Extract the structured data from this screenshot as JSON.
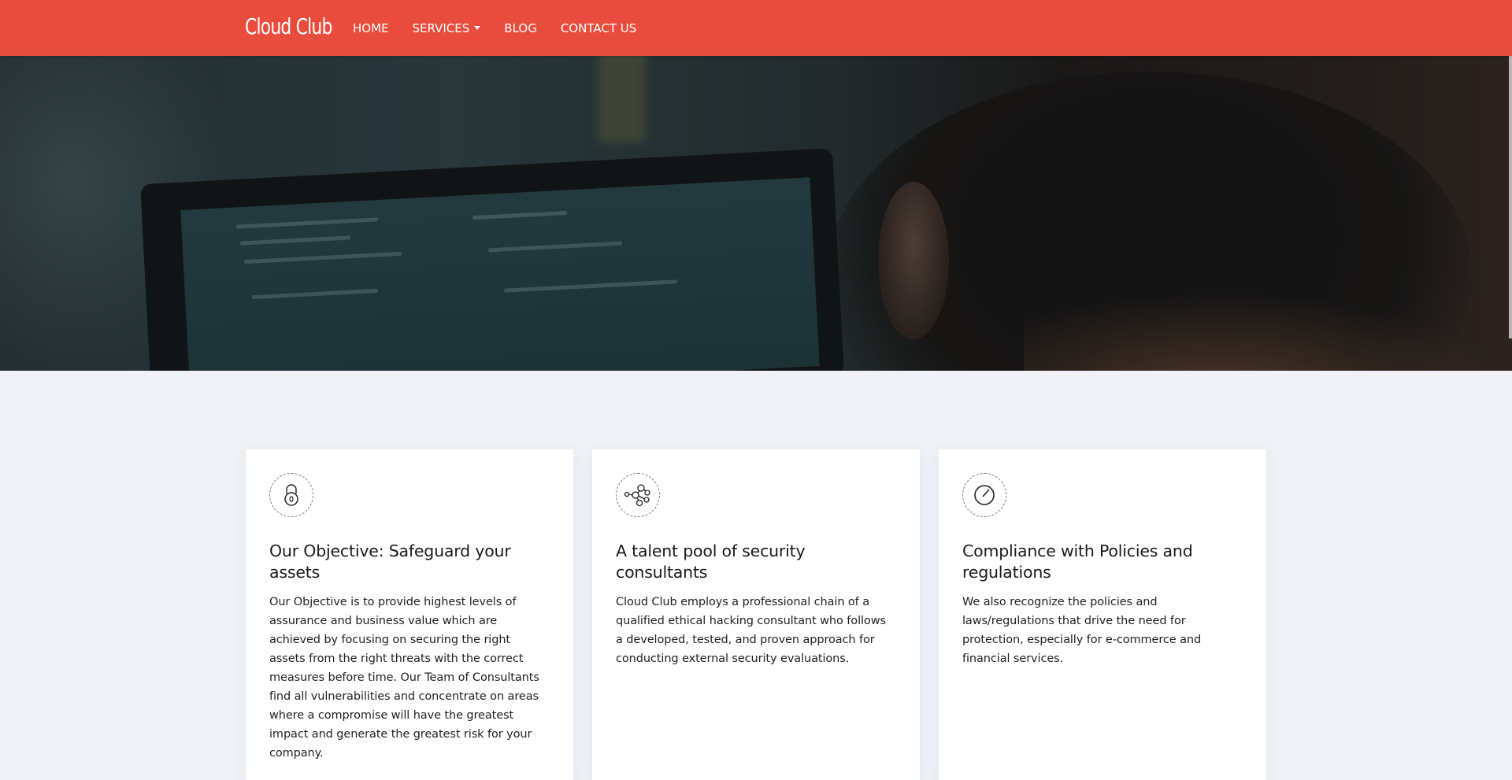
{
  "navbar": {
    "brand": "Cloud Club",
    "items": [
      {
        "label": "HOME"
      },
      {
        "label": "SERVICES"
      },
      {
        "label": "BLOG"
      },
      {
        "label": "CONTACT US"
      }
    ],
    "background": "#e74c3c"
  },
  "features": [
    {
      "icon": "lock-icon",
      "title": "Our Objective: Safeguard your assets",
      "text": "Our Objective is to provide highest levels of assurance and business value which are achieved by focusing on securing the right assets from the right threats with the correct measures before time. Our Team of Consultants find all vulnerabilities and concentrate on areas where a compromise will have the greatest impact and generate the greatest risk for your company."
    },
    {
      "icon": "network-icon",
      "title": "A talent pool of security consultants",
      "text": "Cloud Club employs a professional chain of a qualified ethical hacking consultant who follows a developed, tested, and proven approach for conducting external security evaluations."
    },
    {
      "icon": "gauge-icon",
      "title": "Compliance with Policies and regulations",
      "text": "We also recognize the policies and laws/regulations that drive the need for protection, especially for e-commerce and financial services."
    }
  ]
}
